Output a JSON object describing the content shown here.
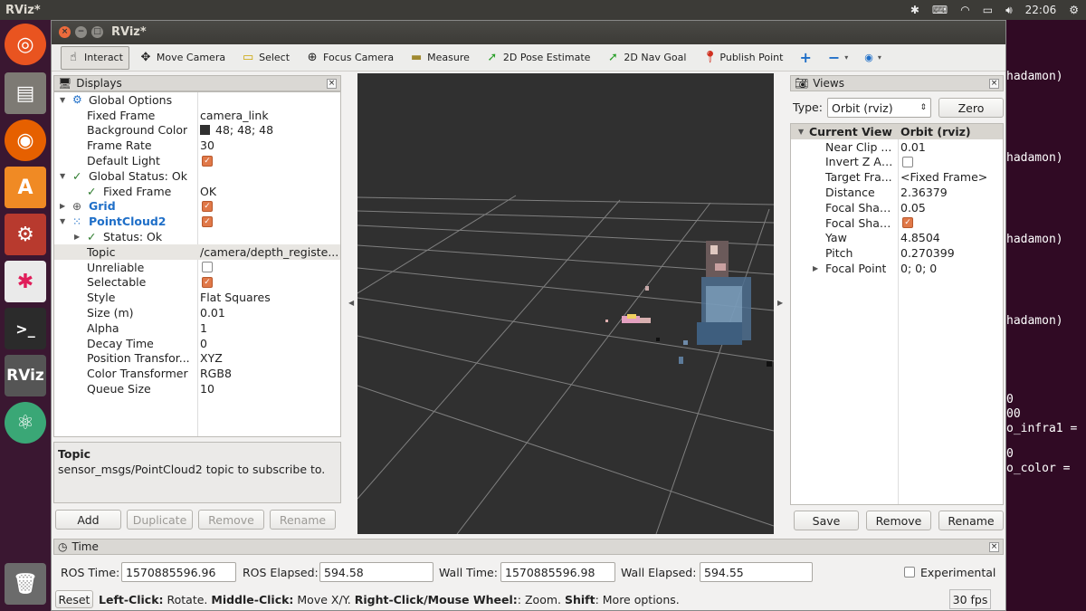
{
  "os": {
    "app_menu_title": "RViz*",
    "clock": "22:06"
  },
  "window": {
    "title": "RViz*"
  },
  "toolbar": {
    "tools": [
      {
        "label": "Interact",
        "icon": "hand-pointer-icon"
      },
      {
        "label": "Move Camera",
        "icon": "move-camera-icon"
      },
      {
        "label": "Select",
        "icon": "select-rect-icon"
      },
      {
        "label": "Focus Camera",
        "icon": "focus-target-icon"
      },
      {
        "label": "Measure",
        "icon": "ruler-icon"
      },
      {
        "label": "2D Pose Estimate",
        "icon": "green-arrow-icon"
      },
      {
        "label": "2D Nav Goal",
        "icon": "green-arrow-icon"
      },
      {
        "label": "Publish Point",
        "icon": "map-pin-icon"
      }
    ]
  },
  "displays": {
    "title": "Displays",
    "rows": [
      {
        "key": "Global Options",
        "value": ""
      },
      {
        "key": "Fixed Frame",
        "value": "camera_link"
      },
      {
        "key": "Background Color",
        "value": "48; 48; 48"
      },
      {
        "key": "Frame Rate",
        "value": "30"
      },
      {
        "key": "Default Light",
        "value": ""
      },
      {
        "key": "Global Status: Ok",
        "value": ""
      },
      {
        "key": "Fixed Frame",
        "value": "OK"
      },
      {
        "key": "Grid",
        "value": ""
      },
      {
        "key": "PointCloud2",
        "value": ""
      },
      {
        "key": "Status: Ok",
        "value": ""
      },
      {
        "key": "Topic",
        "value": "/camera/depth_registe..."
      },
      {
        "key": "Unreliable",
        "value": ""
      },
      {
        "key": "Selectable",
        "value": ""
      },
      {
        "key": "Style",
        "value": "Flat Squares"
      },
      {
        "key": "Size (m)",
        "value": "0.01"
      },
      {
        "key": "Alpha",
        "value": "1"
      },
      {
        "key": "Decay Time",
        "value": "0"
      },
      {
        "key": "Position Transfor...",
        "value": "XYZ"
      },
      {
        "key": "Color Transformer",
        "value": "RGB8"
      },
      {
        "key": "Queue Size",
        "value": "10"
      }
    ],
    "help_title": "Topic",
    "help_text": "sensor_msgs/PointCloud2 topic to subscribe to.",
    "buttons": {
      "add": "Add",
      "duplicate": "Duplicate",
      "remove": "Remove",
      "rename": "Rename"
    }
  },
  "views": {
    "title": "Views",
    "type_label": "Type:",
    "type_value": "Orbit (rviz)",
    "zero_label": "Zero",
    "header_key": "Current View",
    "header_value": "Orbit (rviz)",
    "rows": [
      {
        "key": "Near Clip ...",
        "value": "0.01"
      },
      {
        "key": "Invert Z Axis",
        "value": ""
      },
      {
        "key": "Target Fra...",
        "value": "<Fixed Frame>"
      },
      {
        "key": "Distance",
        "value": "2.36379"
      },
      {
        "key": "Focal Shap...",
        "value": "0.05"
      },
      {
        "key": "Focal Shap...",
        "value": ""
      },
      {
        "key": "Yaw",
        "value": "4.8504"
      },
      {
        "key": "Pitch",
        "value": "0.270399"
      },
      {
        "key": "Focal Point",
        "value": "0; 0; 0"
      }
    ],
    "buttons": {
      "save": "Save",
      "remove": "Remove",
      "rename": "Rename"
    }
  },
  "time": {
    "title": "Time",
    "ros_time_label": "ROS Time:",
    "ros_time": "1570885596.96",
    "ros_elapsed_label": "ROS Elapsed:",
    "ros_elapsed": "594.58",
    "wall_time_label": "Wall Time:",
    "wall_time": "1570885596.98",
    "wall_elapsed_label": "Wall Elapsed:",
    "wall_elapsed": "594.55",
    "experimental_label": "Experimental"
  },
  "statusbar": {
    "reset_label": "Reset",
    "hint_1_bold": "Left-Click:",
    "hint_1": " Rotate. ",
    "hint_2_bold": "Middle-Click:",
    "hint_2": " Move X/Y. ",
    "hint_3_bold": "Right-Click/Mouse Wheel:",
    "hint_3": ": Zoom. ",
    "hint_4_bold": "Shift",
    "hint_4": ": More options.",
    "fps": "30 fps"
  },
  "terminal": {
    "lines": [
      "hadamon)",
      "hadamon)",
      "hadamon)",
      "hadamon)",
      "0",
      "00",
      "o_infra1 =",
      "0",
      "o_color ="
    ]
  },
  "colors": {
    "viewport_bg": "#303030",
    "accent_check": "#e07848",
    "link_blue": "#1f6fc8"
  }
}
